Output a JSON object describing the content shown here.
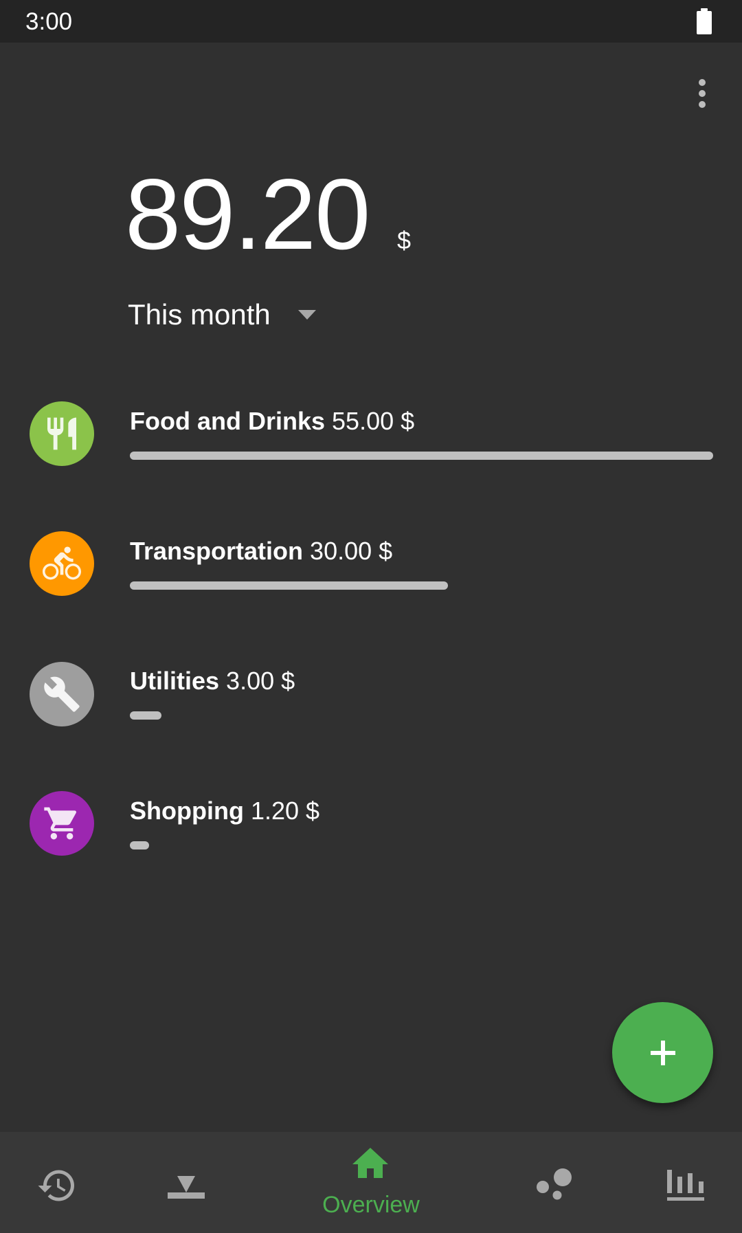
{
  "status_bar": {
    "time": "3:00",
    "battery_icon": "battery-full-icon"
  },
  "toolbar": {
    "overflow_icon": "more-vert-icon"
  },
  "summary": {
    "total_amount": "89.20",
    "currency": "$",
    "period": "This month",
    "period_dropdown_icon": "arrow-drop-down-icon"
  },
  "categories": [
    {
      "name": "Food and Drinks",
      "amount": "55.00 $",
      "value": 55.0,
      "share_of_max": 1.0,
      "icon": "restaurant-icon",
      "color": "#8BC34A",
      "icon_color": "#F1F8E9"
    },
    {
      "name": "Transportation",
      "amount": "30.00 $",
      "value": 30.0,
      "share_of_max": 0.545,
      "icon": "bike-icon",
      "color": "#FF9800",
      "icon_color": "#FFF3E0"
    },
    {
      "name": "Utilities",
      "amount": "3.00 $",
      "value": 3.0,
      "share_of_max": 0.055,
      "icon": "wrench-icon",
      "color": "#9E9E9E",
      "icon_color": "#F5F5F5"
    },
    {
      "name": "Shopping",
      "amount": "1.20 $",
      "value": 1.2,
      "share_of_max": 0.022,
      "icon": "shopping-cart-icon",
      "color": "#9C27B0",
      "icon_color": "#F3E5F5"
    }
  ],
  "fab": {
    "icon": "add-icon",
    "color": "#4CAF50"
  },
  "bottom_nav": {
    "items": [
      {
        "id": "history",
        "icon": "history-icon",
        "label": "",
        "active": false
      },
      {
        "id": "import",
        "icon": "download-icon",
        "label": "",
        "active": false
      },
      {
        "id": "overview",
        "icon": "home-icon",
        "label": "Overview",
        "active": true
      },
      {
        "id": "bubbles",
        "icon": "bubble-chart-icon",
        "label": "",
        "active": false
      },
      {
        "id": "stats",
        "icon": "bar-chart-icon",
        "label": "",
        "active": false
      }
    ],
    "active_color": "#4CAF50",
    "inactive_color": "#A8A8A8"
  }
}
